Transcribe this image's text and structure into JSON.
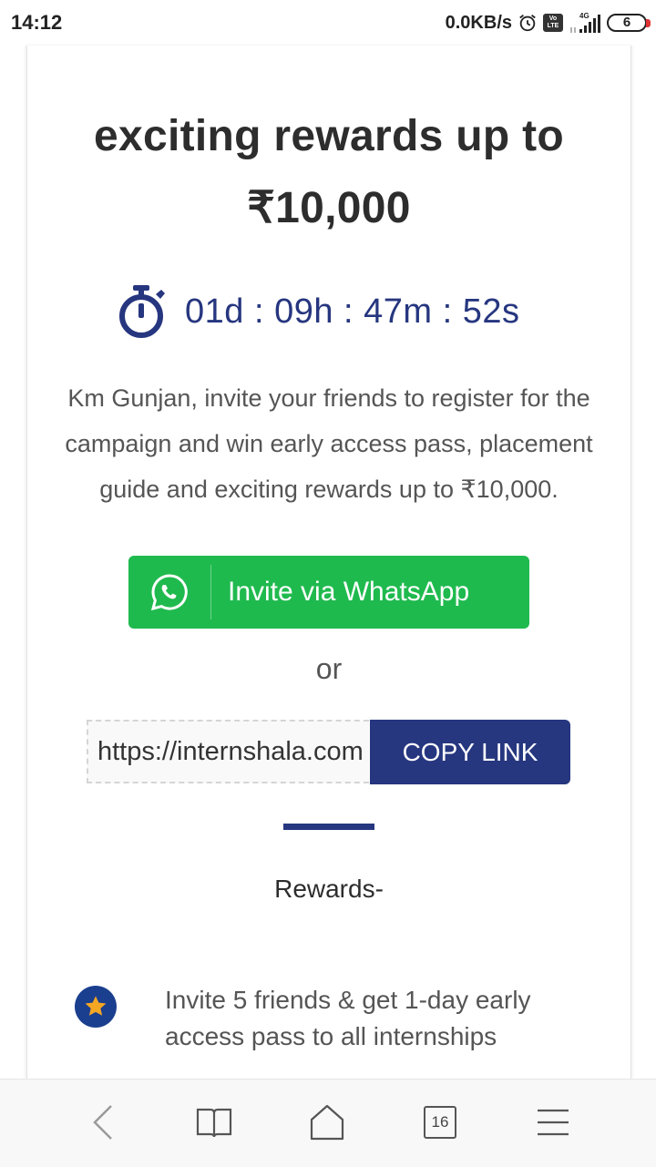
{
  "status_bar": {
    "time": "14:12",
    "net_speed": "0.0KB/s",
    "volte": "Vo LTE",
    "network": "4G",
    "battery": "6"
  },
  "hero": {
    "headline_line1": "exciting rewards up to",
    "headline_line2": "₹10,000",
    "countdown": "01d : 09h : 47m : 52s",
    "description": "Km Gunjan, invite your friends to register for the campaign and win early access pass, placement guide and exciting rewards up to ₹10,000."
  },
  "actions": {
    "whatsapp_label": "Invite via WhatsApp",
    "or_label": "or",
    "link_value": "https://internshala.com",
    "copy_label": "COPY LINK"
  },
  "rewards": {
    "heading": "Rewards-",
    "items": [
      {
        "text": "Invite 5 friends & get 1-day early access pass to all internships"
      }
    ]
  },
  "bottom_nav": {
    "tabs_count": "16"
  },
  "colors": {
    "brand_blue": "#26367f",
    "whatsapp_green": "#1fba4e",
    "star_gold": "#f5a623"
  }
}
